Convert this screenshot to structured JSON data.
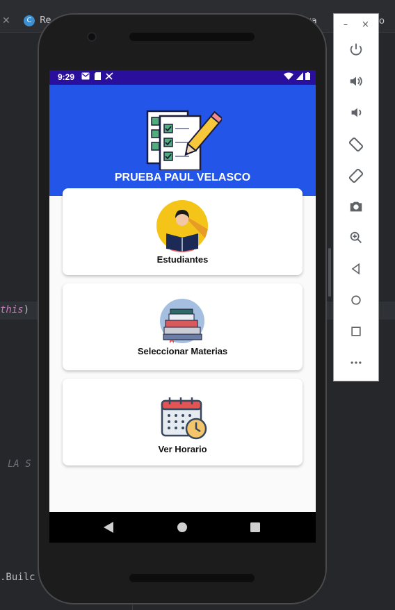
{
  "ide": {
    "tab_label": "Re",
    "tab_right_label": "va",
    "tab_far_right": "o",
    "code_this": "this",
    "code_paren": ")",
    "code_la": "LA S",
    "code_build": ".Builc"
  },
  "emulator_toolbar": {
    "minimize_label": "–",
    "close_label": "×",
    "buttons": [
      {
        "name": "power-icon",
        "glyph": "⏻"
      },
      {
        "name": "volume-up-icon",
        "glyph": "🔊"
      },
      {
        "name": "volume-down-icon",
        "glyph": "🔉"
      },
      {
        "name": "rotate-left-icon",
        "glyph": "⟲"
      },
      {
        "name": "rotate-right-icon",
        "glyph": "⟳"
      },
      {
        "name": "camera-icon",
        "glyph": "📷"
      },
      {
        "name": "zoom-icon",
        "glyph": "🔍"
      },
      {
        "name": "back-icon",
        "glyph": "◁"
      },
      {
        "name": "home-icon",
        "glyph": "○"
      },
      {
        "name": "overview-icon",
        "glyph": "□"
      },
      {
        "name": "more-icon",
        "glyph": "•••"
      }
    ]
  },
  "statusbar": {
    "time": "9:29"
  },
  "app": {
    "title": "PRUEBA PAUL VELASCO",
    "accent_color": "#2255e8",
    "statusbar_color": "#2a0f9c",
    "cards": [
      {
        "label": "Estudiantes",
        "icon": "student-reading-icon"
      },
      {
        "label": "Seleccionar Materias",
        "icon": "books-stack-icon"
      },
      {
        "label": "Ver Horario",
        "icon": "calendar-clock-icon"
      }
    ]
  }
}
